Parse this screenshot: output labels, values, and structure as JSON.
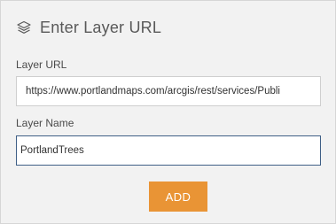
{
  "header": {
    "icon": "layers-icon",
    "title": "Enter Layer URL"
  },
  "form": {
    "url_label": "Layer URL",
    "url_value": "https://www.portlandmaps.com/arcgis/rest/services/Publi",
    "name_label": "Layer Name",
    "name_value": "PortlandTrees"
  },
  "actions": {
    "add_label": "ADD"
  },
  "colors": {
    "panel_bg": "#f2f2f2",
    "accent": "#e99435",
    "focus_border": "#3f5f86",
    "text": "#595959"
  }
}
